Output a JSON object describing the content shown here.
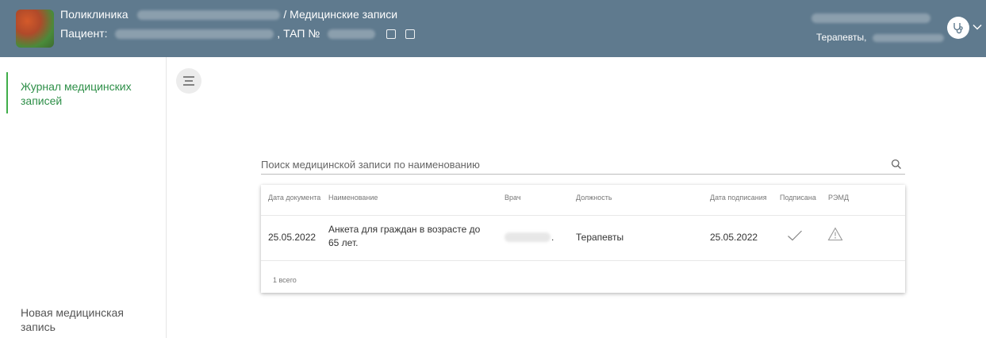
{
  "header": {
    "clinic_label": "Поликлиника",
    "section_title": "/ Медицинские записи",
    "patient_label": "Пациент:",
    "tap_label": ", ТАП №",
    "role": "Терапевты,"
  },
  "sidebar": {
    "items": [
      {
        "label": "Журнал медицинских записей",
        "active": true
      },
      {
        "label": "Новая медицинская запись",
        "active": false
      }
    ]
  },
  "search": {
    "placeholder": "Поиск медицинской записи по наименованию"
  },
  "table": {
    "columns": [
      "Дата документа",
      "Наименование",
      "Врач",
      "Должность",
      "Дата подписания",
      "Подписана",
      "РЭМД"
    ],
    "rows": [
      {
        "date": "25.05.2022",
        "name": "Анкета для граждан в возрасте до 65 лет.",
        "doctor_suffix": ".",
        "position": "Терапевты",
        "signed_date": "25.05.2022",
        "signed_icon": "check-icon",
        "remd_icon": "warning-icon"
      }
    ],
    "total": "1 всего"
  },
  "colors": {
    "header_bg": "#5f7a8e",
    "accent_green": "#3fae4a"
  }
}
